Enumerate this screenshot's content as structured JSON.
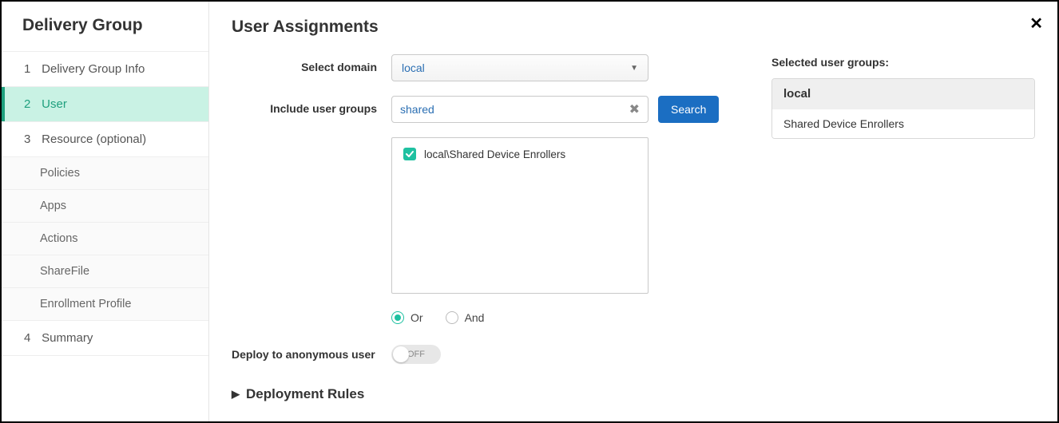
{
  "sidebar": {
    "title": "Delivery Group",
    "items": [
      {
        "num": "1",
        "label": "Delivery Group Info"
      },
      {
        "num": "2",
        "label": "User"
      },
      {
        "num": "3",
        "label": "Resource (optional)"
      },
      {
        "num": "4",
        "label": "Summary"
      }
    ],
    "subitems": [
      {
        "label": "Policies"
      },
      {
        "label": "Apps"
      },
      {
        "label": "Actions"
      },
      {
        "label": "ShareFile"
      },
      {
        "label": "Enrollment Profile"
      }
    ]
  },
  "main": {
    "title": "User Assignments",
    "labels": {
      "select_domain": "Select domain",
      "include_user_groups": "Include user groups",
      "deploy_anonymous": "Deploy to anonymous user"
    },
    "domain_selected": "local",
    "search_value": "shared",
    "search_button": "Search",
    "results": [
      {
        "label": "local\\Shared Device Enrollers",
        "checked": true
      }
    ],
    "operator": {
      "or_label": "Or",
      "and_label": "And",
      "selected": "or"
    },
    "toggle_state": "OFF",
    "deployment_rules_title": "Deployment Rules"
  },
  "right": {
    "title": "Selected user groups:",
    "group_header": "local",
    "group_items": [
      {
        "label": "Shared Device Enrollers"
      }
    ]
  }
}
